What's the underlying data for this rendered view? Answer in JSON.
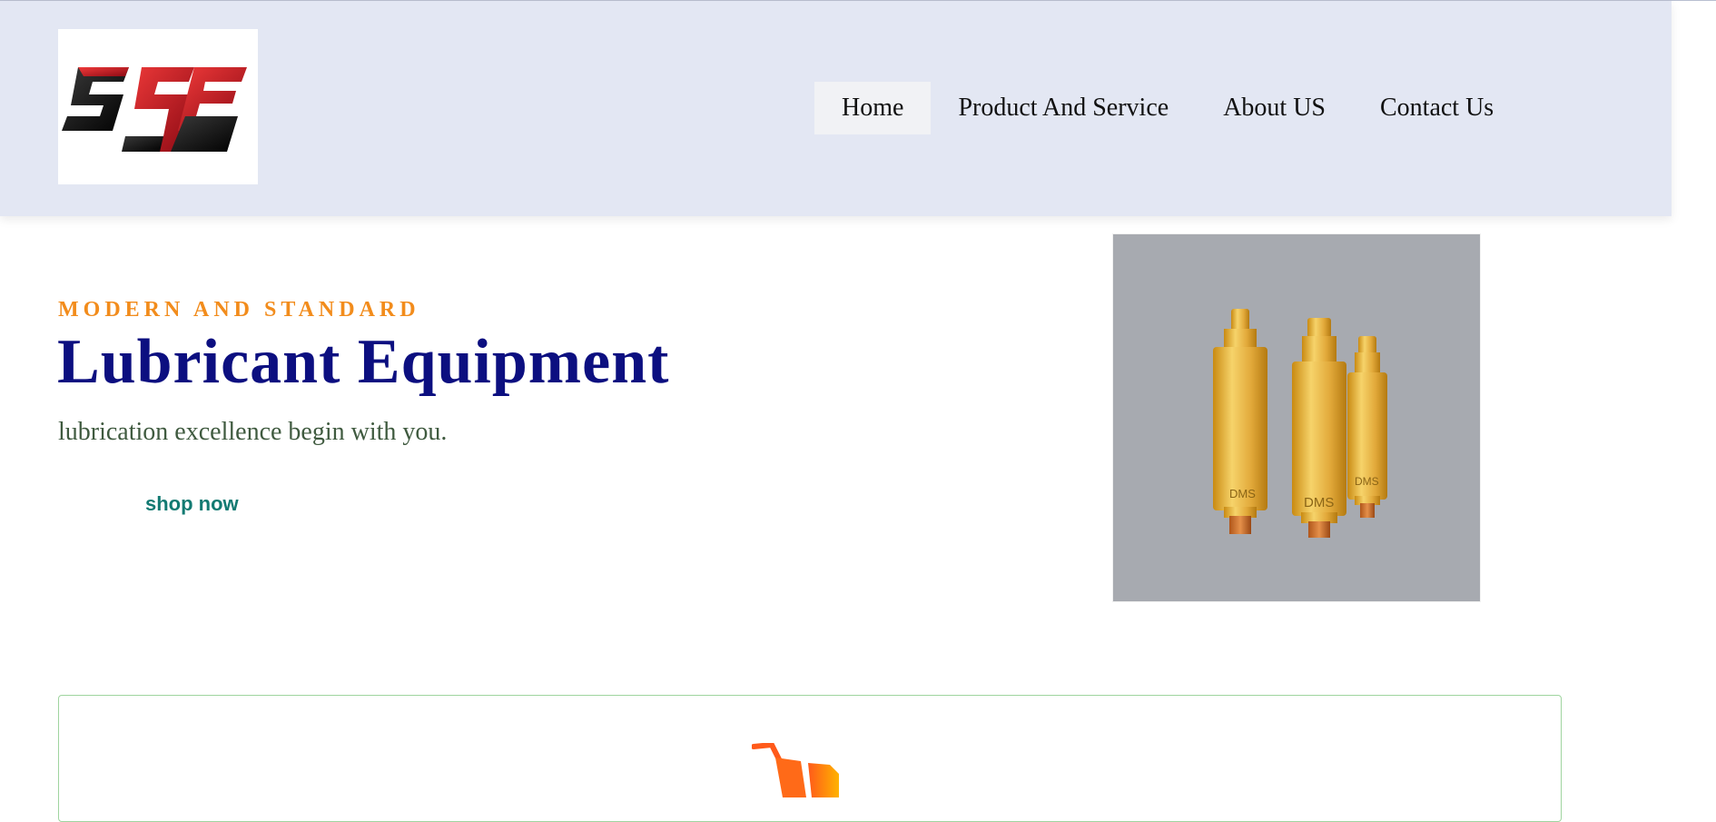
{
  "header": {
    "logo": {
      "text": "SSE",
      "icon": "sse-logo"
    },
    "nav": [
      {
        "label": "Home",
        "active": true
      },
      {
        "label": "Product And Service",
        "active": false
      },
      {
        "label": "About US",
        "active": false
      },
      {
        "label": "Contact Us",
        "active": false
      }
    ]
  },
  "hero": {
    "eyebrow": "MODERN AND STANDARD",
    "title": "Lubricant Equipment",
    "tagline": "lubrication excellence begin with you.",
    "cta_label": "shop now",
    "image": {
      "icon": "brass-nozzles-photo",
      "labels": [
        "DMS",
        "DMS",
        "DMS"
      ]
    }
  },
  "features": {
    "card_icon": "shopping-cart-icon"
  },
  "colors": {
    "header_bg": "#e3e7f3",
    "eyebrow": "#f28c1c",
    "title": "#0c0f80",
    "tagline": "#3f5a3f",
    "cta": "#127a72",
    "card_border": "#9fd49f",
    "logo_red": "#d0202a"
  }
}
